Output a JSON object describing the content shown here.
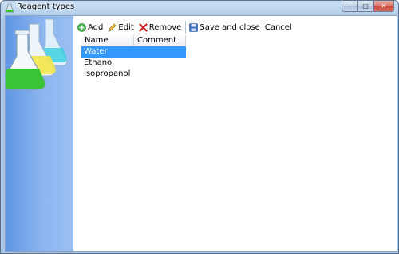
{
  "window": {
    "title": "Reagent types"
  },
  "titlebar_buttons": {
    "minimize": "–",
    "maximize": "□",
    "close": "✕"
  },
  "toolbar": {
    "add": "Add",
    "edit": "Edit",
    "remove": "Remove",
    "save_close": "Save and close",
    "cancel": "Cancel"
  },
  "grid": {
    "columns": [
      "Name",
      "Comment"
    ],
    "rows": [
      {
        "name": "Water",
        "comment": "",
        "selected": true
      },
      {
        "name": "Ethanol",
        "comment": "",
        "selected": false
      },
      {
        "name": "Isopropanol",
        "comment": "",
        "selected": false
      }
    ]
  },
  "colors": {
    "selection": "#3399ff",
    "banner": "#8db6f0"
  }
}
